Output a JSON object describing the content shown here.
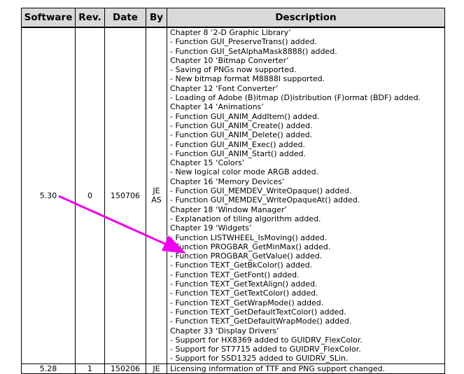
{
  "table": {
    "headers": [
      "Software",
      "Rev.",
      "Date",
      "By",
      "Description"
    ],
    "rows": [
      {
        "software": "5.30",
        "rev": "0",
        "date": "150706",
        "by_lines": [
          "JE",
          "AS"
        ],
        "description": [
          "Chapter 8 ‘2-D Graphic Library’",
          "- Function GUI_PreserveTrans() added.",
          "- Function GUI_SetAlphaMask8888() added.",
          "Chapter 10 ‘Bitmap Converter’",
          "- Saving of PNGs now supported.",
          "- New bitmap format M8888I supported.",
          "Chapter 12 ‘Font Converter’",
          "- Loading of Adobe (B)itmap (D)istribution (F)ormat (BDF) added.",
          "Chapter 14 ‘Animations’",
          "- Function GUI_ANIM_AddItem() added.",
          "- Function GUI_ANIM_Create() added.",
          "- Function GUI_ANIM_Delete() added.",
          "- Function GUI_ANIM_Exec() added.",
          "- Function GUI_ANIM_Start() added.",
          "Chapter 15 ‘Colors’",
          "- New logical color mode ARGB added.",
          "Chapter 16 ‘Memory Devices’",
          "- Function GUI_MEMDEV_WriteOpaque() added.",
          "- Function GUI_MEMDEV_WriteOpaqueAt() added.",
          "Chapter 18 ‘Window Manager’",
          "- Explanation of tiling algorithm added.",
          "Chapter 19 ‘Widgets’",
          "- Function LISTWHEEL_IsMoving() added.",
          "- Function PROGBAR_GetMinMax() added.",
          "- Function PROGBAR_GetValue() added.",
          "- Function TEXT_GetBkColor() added.",
          "- Function TEXT_GetFont() added.",
          "- Function TEXT_GetTextAlign() added.",
          "- Function TEXT_GetTextColor() added.",
          "- Function TEXT_GetWrapMode() added.",
          "- Function TEXT_GetDefaultTextColor() added.",
          "- Function TEXT_GetDefaultWrapMode() added.",
          "Chapter 33 ‘Display Drivers’",
          "- Support for HX8369 added to GUIDRV_FlexColor.",
          "- Support for ST7715 added to GUIDRV_FlexColor.",
          "- Support for SSD1325 added to GUIDRV_SLin."
        ]
      },
      {
        "software": "5.28",
        "rev": "1",
        "date": "150206",
        "by": "JE",
        "description": "Licensing information of TTF and PNG support changed."
      }
    ]
  },
  "annotation": {
    "color": "#ee00ee"
  }
}
